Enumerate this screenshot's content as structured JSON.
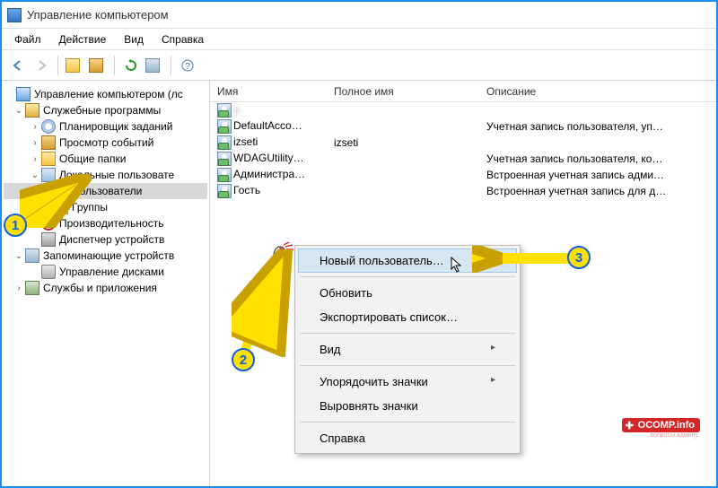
{
  "window": {
    "title": "Управление компьютером"
  },
  "menubar": {
    "file": "Файл",
    "action": "Действие",
    "view": "Вид",
    "help": "Справка"
  },
  "tree": {
    "root": "Управление компьютером (лс",
    "svc": "Служебные программы",
    "sched": "Планировщик заданий",
    "events": "Просмотр событий",
    "shared": "Общие папки",
    "local": "Локальные пользовате",
    "users": "Пользователи",
    "groups": "Группы",
    "perf": "Производительность",
    "devmgr": "Диспетчер устройств",
    "storage": "Запоминающие устройств",
    "diskmgr": "Управление дисками",
    "services": "Службы и приложения"
  },
  "list": {
    "headers": {
      "name": "Имя",
      "full": "Полное имя",
      "desc": "Описание"
    },
    "rows": [
      {
        "name": "a",
        "full": "",
        "desc": "",
        "blurred": true
      },
      {
        "name": "DefaultAcco…",
        "full": "",
        "desc": "Учетная запись пользователя, уп…"
      },
      {
        "name": "izseti",
        "full": "izseti",
        "desc": ""
      },
      {
        "name": "WDAGUtility…",
        "full": "",
        "desc": "Учетная запись пользователя, ко…"
      },
      {
        "name": "Администра…",
        "full": "",
        "desc": "Встроенная учетная запись адми…"
      },
      {
        "name": "Гость",
        "full": "",
        "desc": "Встроенная учетная запись для д…"
      }
    ]
  },
  "context_menu": {
    "new_user": "Новый пользователь…",
    "refresh": "Обновить",
    "export": "Экспортировать список…",
    "view": "Вид",
    "arrange": "Упорядочить значки",
    "align": "Выровнять значки",
    "help": "Справка"
  },
  "annotations": {
    "b1": "1",
    "b2": "2",
    "b3": "3"
  },
  "watermark": {
    "main": "OCOMP.info",
    "sub": "вопросы админу"
  }
}
